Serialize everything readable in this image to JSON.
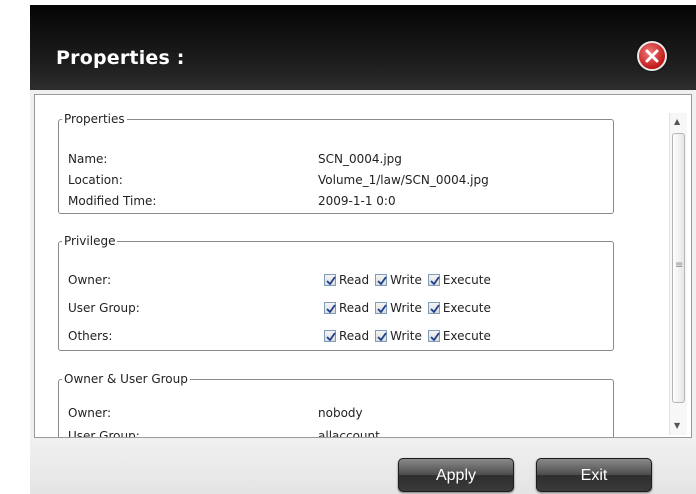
{
  "dialog": {
    "title": "Properties :",
    "apply_label": "Apply",
    "exit_label": "Exit"
  },
  "properties": {
    "legend": "Properties",
    "rows": [
      {
        "label": "Name:",
        "value": "SCN_0004.jpg"
      },
      {
        "label": "Location:",
        "value": "Volume_1/law/SCN_0004.jpg"
      },
      {
        "label": "Modified Time:",
        "value": "2009-1-1 0:0"
      }
    ]
  },
  "privilege": {
    "legend": "Privilege",
    "perm_labels": {
      "read": "Read",
      "write": "Write",
      "execute": "Execute"
    },
    "rows": [
      {
        "label": "Owner:",
        "read": true,
        "write": true,
        "execute": true
      },
      {
        "label": "User Group:",
        "read": true,
        "write": true,
        "execute": true
      },
      {
        "label": "Others:",
        "read": true,
        "write": true,
        "execute": true
      }
    ]
  },
  "owner_group": {
    "legend": "Owner & User Group",
    "rows": [
      {
        "label": "Owner:",
        "value": "nobody"
      },
      {
        "label": "User Group:",
        "value": "allaccount"
      }
    ]
  },
  "colors": {
    "title_bar": "#1a1a1a",
    "close_button": "#c21818",
    "checkbox_check": "#1f3f8c",
    "button_dark": "#3a3a3a"
  }
}
